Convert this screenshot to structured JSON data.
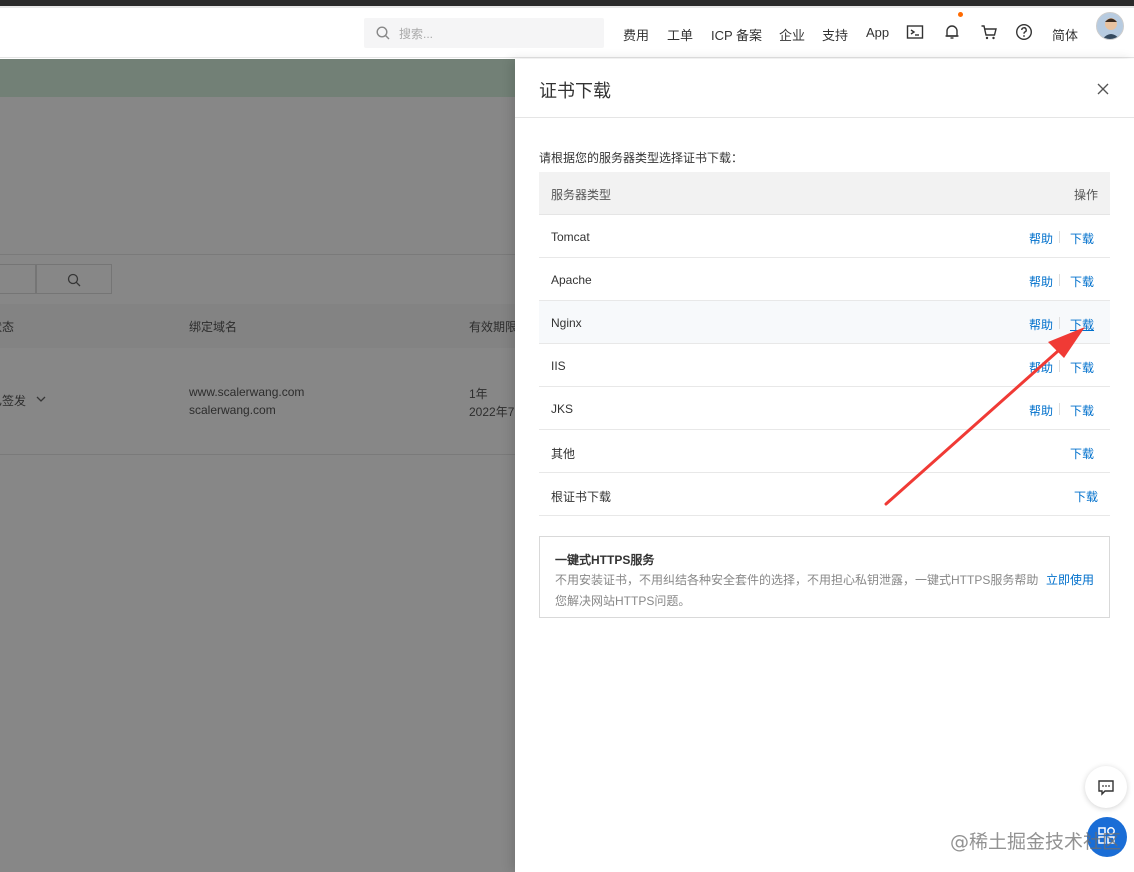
{
  "topnav": {
    "search_placeholder": "搜索...",
    "links": [
      "费用",
      "工单",
      "ICP 备案",
      "企业",
      "支持",
      "App"
    ],
    "language": "简体",
    "icons": [
      "terminal-icon",
      "bell-icon",
      "cart-icon",
      "help-icon"
    ]
  },
  "background": {
    "table_headers": [
      "状态",
      "绑定域名",
      "有效期限"
    ],
    "row": {
      "status": "已签发",
      "domain_1": "www.scalerwang.com",
      "domain_2": "scalerwang.com",
      "period": "1年",
      "date_partial": "2022年7"
    }
  },
  "drawer": {
    "title": "证书下载",
    "intro": "请根据您的服务器类型选择证书下载：",
    "col_server": "服务器类型",
    "col_action": "操作",
    "help_label": "帮助",
    "download_label": "下载",
    "rows": [
      {
        "name": "Tomcat"
      },
      {
        "name": "Apache"
      },
      {
        "name": "Nginx"
      },
      {
        "name": "IIS"
      },
      {
        "name": "JKS"
      },
      {
        "name": "其他"
      },
      {
        "name": "根证书下载"
      }
    ],
    "https_card": {
      "title": "一键式HTTPS服务",
      "desc_line1": "不用安装证书，不用纠结各种安全套件的选择，不用担心私钥泄露，一键式HTTPS服务帮助",
      "desc_line2": "您解决网站HTTPS问题。",
      "action": "立即使用"
    }
  },
  "watermark": "@稀土掘金技术社区",
  "colors": {
    "link": "#0070cc",
    "accent_orange": "#ff6a00",
    "arrow_red": "#f03a35",
    "float_blue": "#1a6dd6"
  }
}
